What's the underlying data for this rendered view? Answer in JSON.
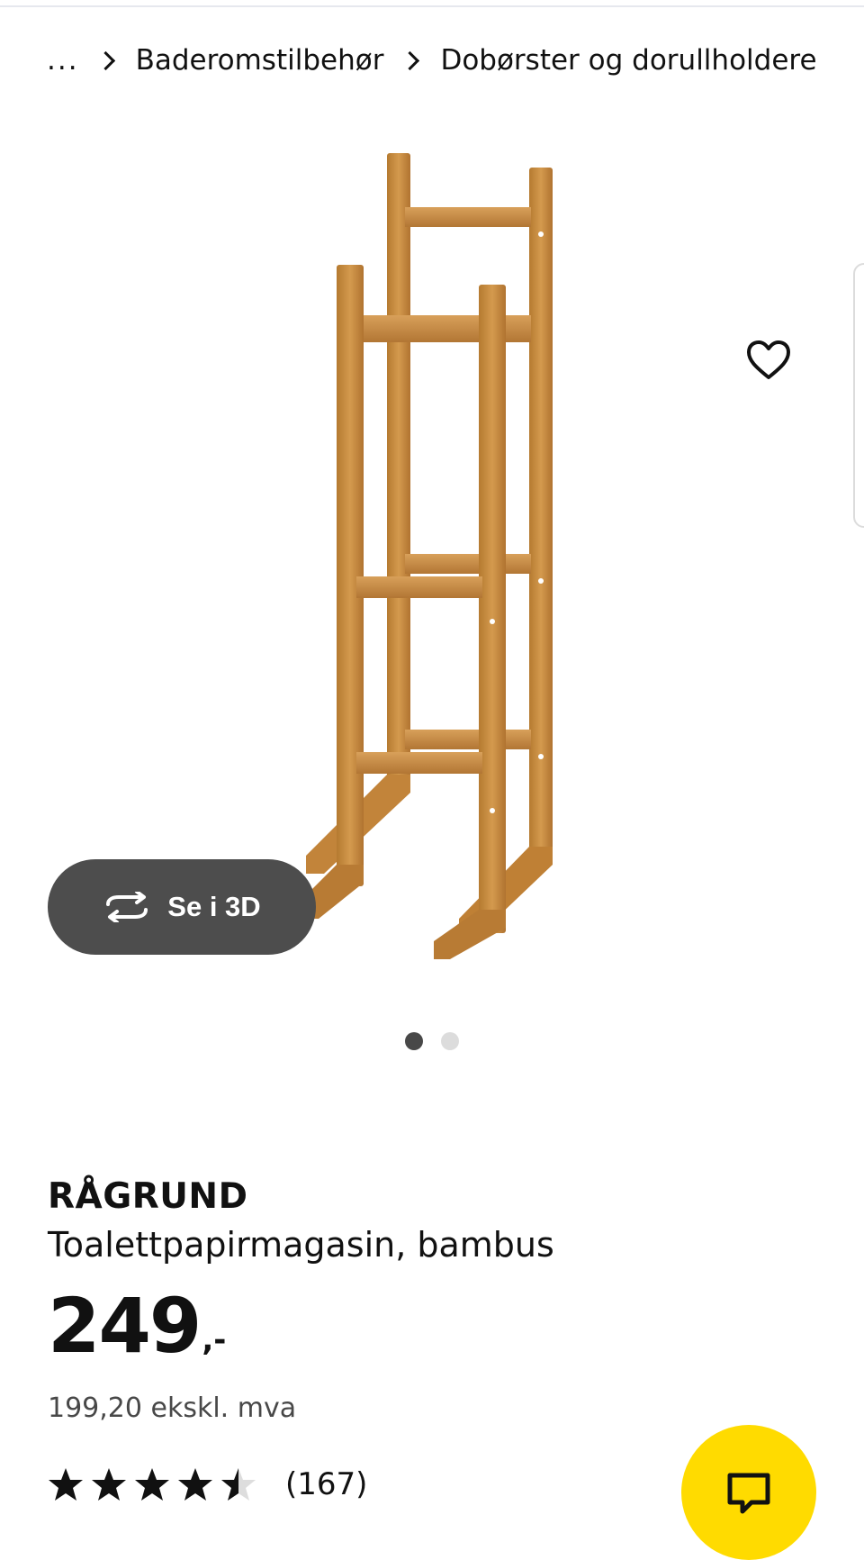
{
  "breadcrumb": {
    "ellipsis": "...",
    "items": [
      "Baderomstilbehør",
      "Dobørster og dorullholdere"
    ]
  },
  "product": {
    "brand": "RÅGRUND",
    "description": "Toalettpapirmagasin, bambus",
    "price_integer": "249",
    "price_suffix": ",-",
    "price_ex_vat": "199,20 ekskl. mva",
    "rating_value": 4.5,
    "rating_max": 5,
    "review_count": "(167)"
  },
  "gallery": {
    "view_3d_label": "Se i 3D",
    "slide_count": 2,
    "active_slide": 1
  },
  "icons": {
    "favorite": "heart-icon",
    "view_3d": "rotate-3d-icon",
    "chat": "chat-icon"
  },
  "colors": {
    "accent_yellow": "#ffdb00",
    "pill_background": "#4d4d4d",
    "bamboo": "#c78a3c"
  }
}
